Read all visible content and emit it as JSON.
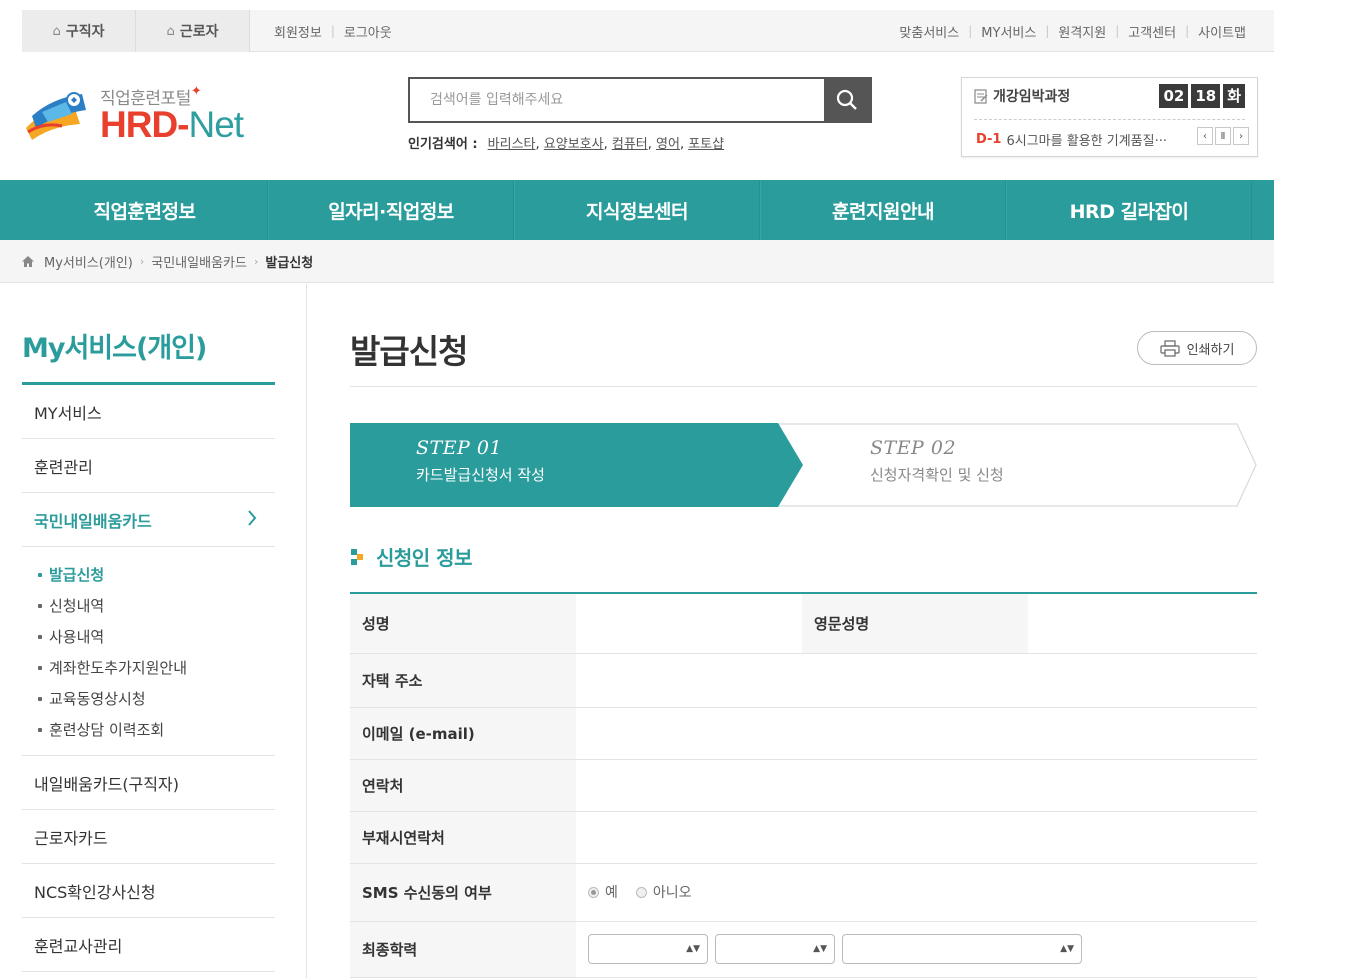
{
  "topbar": {
    "user_tabs": [
      "구직자",
      "근로자"
    ],
    "left_links": [
      "회원정보",
      "로그아웃"
    ],
    "right_links": [
      "맞춤서비스",
      "MY서비스",
      "원격지원",
      "고객센터",
      "사이트맵"
    ]
  },
  "logo": {
    "sub": "직업훈련포털",
    "main_a": "HRD",
    "main_dash": "-",
    "main_b": "Net"
  },
  "search": {
    "placeholder": "검색어를 입력해주세요",
    "popular_label": "인기검색어 :",
    "popular": [
      "바리스타",
      "요양보호사",
      "컴퓨터",
      "영어",
      "포토샵"
    ]
  },
  "notice": {
    "title": "개강임박과정",
    "date": [
      "02",
      "18",
      "화"
    ],
    "dday": "D-1",
    "text": "6시그마를 활용한 기계품질···"
  },
  "gnb": [
    "직업훈련정보",
    "일자리·직업정보",
    "지식정보센터",
    "훈련지원안내",
    "HRD 길라잡이"
  ],
  "breadcrumb": [
    "My서비스(개인)",
    "국민내일배움카드",
    "발급신청"
  ],
  "sidebar": {
    "title": "My서비스(개인)",
    "items_top": [
      "MY서비스",
      "훈련관리"
    ],
    "active": "국민내일배움카드",
    "sub": [
      "발급신청",
      "신청내역",
      "사용내역",
      "계좌한도추가지원안내",
      "교육동영상시청",
      "훈련상담 이력조회"
    ],
    "items_bottom": [
      "내일배움카드(구직자)",
      "근로자카드",
      "NCS확인강사신청",
      "훈련교사관리"
    ]
  },
  "content": {
    "title": "발급신청",
    "print": "인쇄하기",
    "steps": [
      {
        "no": "STEP 01",
        "desc": "카드발급신청서 작성"
      },
      {
        "no": "STEP 02",
        "desc": "신청자격확인 및 신청"
      }
    ],
    "section": "신청인 정보",
    "fields": {
      "name": "성명",
      "eng_name": "영문성명",
      "address": "자택 주소",
      "email": "이메일 (e-mail)",
      "phone": "연락처",
      "alt_phone": "부재시연락처",
      "sms": "SMS 수신동의 여부",
      "edu": "최종학력"
    },
    "sms_options": [
      "예",
      "아니오"
    ]
  },
  "colors": {
    "primary": "#2b9c9c",
    "accent": "#e8402c"
  }
}
